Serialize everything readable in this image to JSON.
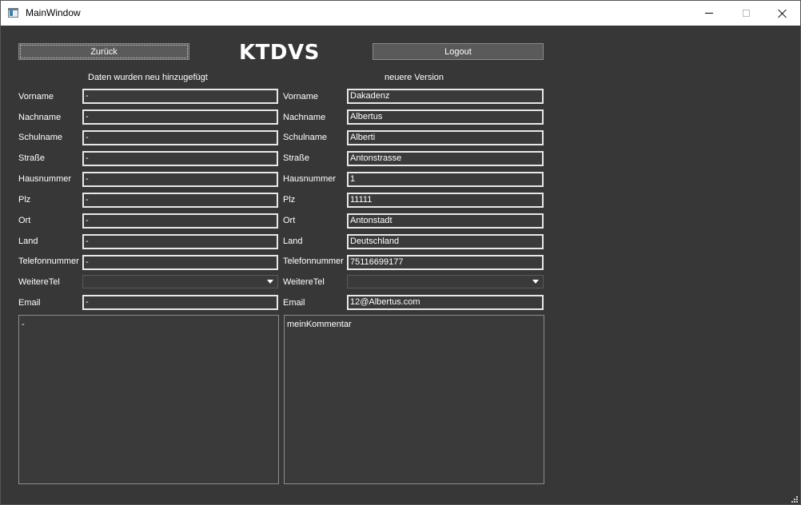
{
  "window": {
    "title": "MainWindow"
  },
  "header": {
    "back_label": "Zurück",
    "brand": "KTDVS",
    "logout_label": "Logout"
  },
  "left": {
    "section_title": "Daten wurden neu hinzugefügt",
    "labels": {
      "vorname": "Vorname",
      "nachname": "Nachname",
      "schulname": "Schulname",
      "strasse": "Straße",
      "hausnummer": "Hausnummer",
      "plz": "Plz",
      "ort": "Ort",
      "land": "Land",
      "telefonnummer": "Telefonnummer",
      "weitere_tel": "WeitereTel",
      "email": "Email"
    },
    "values": {
      "vorname": "-",
      "nachname": "-",
      "schulname": "-",
      "strasse": "-",
      "hausnummer": "-",
      "plz": "-",
      "ort": "-",
      "land": "-",
      "telefonnummer": "-",
      "weitere_tel": "",
      "email": "-"
    },
    "comment": "-"
  },
  "right": {
    "section_title": "neuere Version",
    "labels": {
      "vorname": "Vorname",
      "nachname": "Nachname",
      "schulname": "Schulname",
      "strasse": "Straße",
      "hausnummer": "Hausnummer",
      "plz": "Plz",
      "ort": "Ort",
      "land": "Land",
      "telefonnummer": "Telefonnummer",
      "weitere_tel": "WeitereTel",
      "email": "Email"
    },
    "values": {
      "vorname": "Dakadenz",
      "nachname": "Albertus",
      "schulname": "Alberti",
      "strasse": "Antonstrasse",
      "hausnummer": "1",
      "plz": "11111",
      "ort": "Antonstadt",
      "land": "Deutschland",
      "telefonnummer": "75116699177",
      "weitere_tel": "",
      "email": "12@Albertus.com"
    },
    "comment": "meinKommentar"
  },
  "icons": {
    "app": "app-window-icon",
    "minimize": "minimize-icon",
    "maximize": "maximize-icon",
    "close": "close-icon",
    "dropdown": "chevron-down-icon",
    "resize": "resize-grip-icon"
  }
}
